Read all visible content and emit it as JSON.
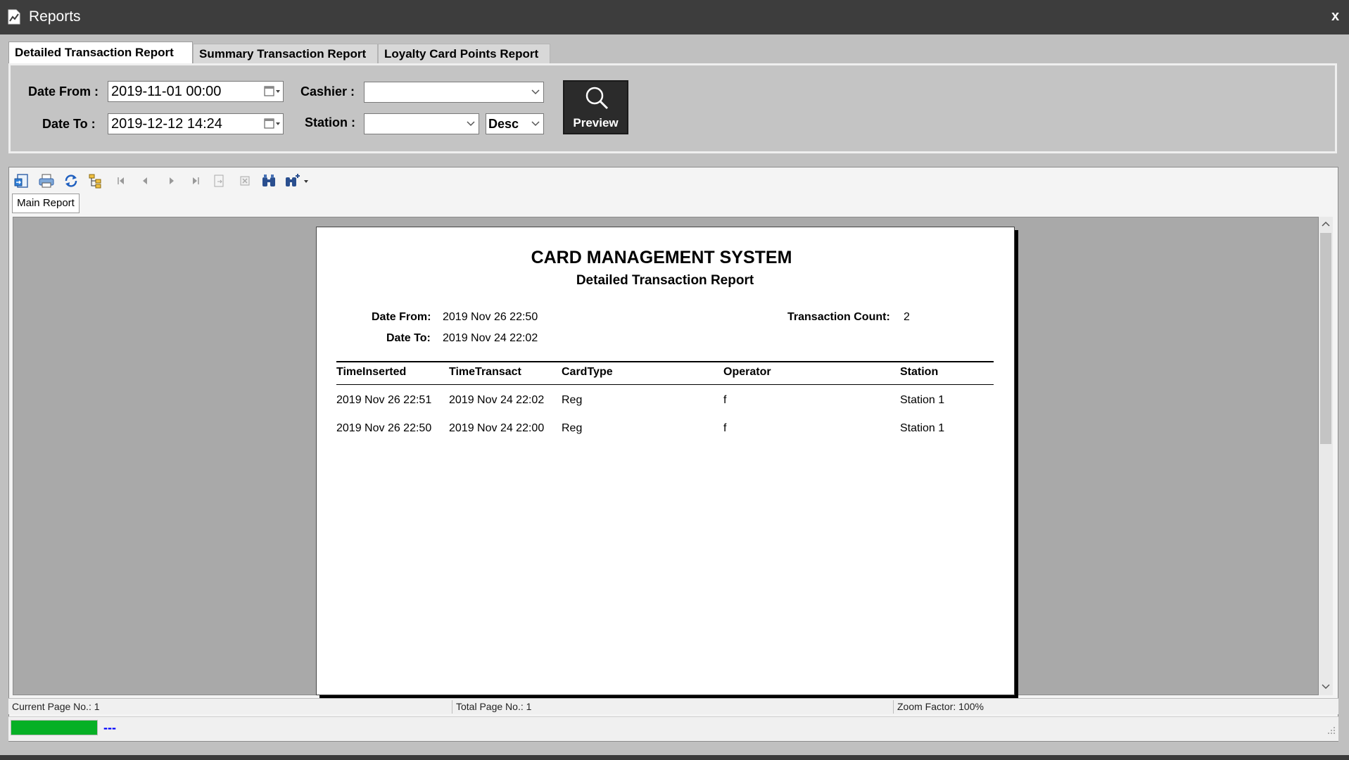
{
  "window": {
    "title": "Reports",
    "close_label": "x"
  },
  "tabs": [
    {
      "label": "Detailed Transaction Report",
      "active": true
    },
    {
      "label": "Summary Transaction Report",
      "active": false
    },
    {
      "label": "Loyalty Card Points Report",
      "active": false
    }
  ],
  "filters": {
    "date_from_label": "Date From :",
    "date_from_value": "2019-11-01 00:00",
    "date_to_label": "Date To :",
    "date_to_value": "2019-12-12 14:24",
    "cashier_label": "Cashier :",
    "cashier_value": "",
    "station_label": "Station :",
    "station_value": "",
    "sort_value": "Desc",
    "preview_label": "Preview"
  },
  "viewer": {
    "toolbar_icons": [
      "export-icon",
      "print-icon",
      "refresh-icon",
      "group-tree-icon",
      "first-page-icon",
      "previous-page-icon",
      "next-page-icon",
      "last-page-icon",
      "goto-page-icon",
      "close-view-icon",
      "search-text-icon",
      "zoom-icon"
    ],
    "main_report_tab": "Main Report"
  },
  "report": {
    "title": "CARD MANAGEMENT SYSTEM",
    "subtitle": "Detailed Transaction Report",
    "date_from_label": "Date From:",
    "date_from_value": "2019 Nov 26  22:50",
    "date_to_label": "Date To:",
    "date_to_value": "2019 Nov 24  22:02",
    "count_label": "Transaction Count:",
    "count_value": "2",
    "columns": [
      "TimeInserted",
      "TimeTransact",
      "CardType",
      "Operator",
      "Station"
    ],
    "rows": [
      [
        "2019 Nov 26  22:51",
        "2019 Nov 24  22:02",
        "Reg",
        "f",
        "Station 1"
      ],
      [
        "2019 Nov 26  22:50",
        "2019 Nov 24  22:00",
        "Reg",
        "f",
        "Station 1"
      ]
    ]
  },
  "status": {
    "current_page": "Current Page No.: 1",
    "total_page": "Total Page No.: 1",
    "zoom": "Zoom Factor: 100%"
  },
  "progress": {
    "text": "---",
    "fill_fraction": 1.0,
    "color": "#06b025"
  },
  "colors": {
    "titlebar": "#3d3d3d",
    "preview_button": "#2b2b2b",
    "panel": "#c4c4c4"
  }
}
